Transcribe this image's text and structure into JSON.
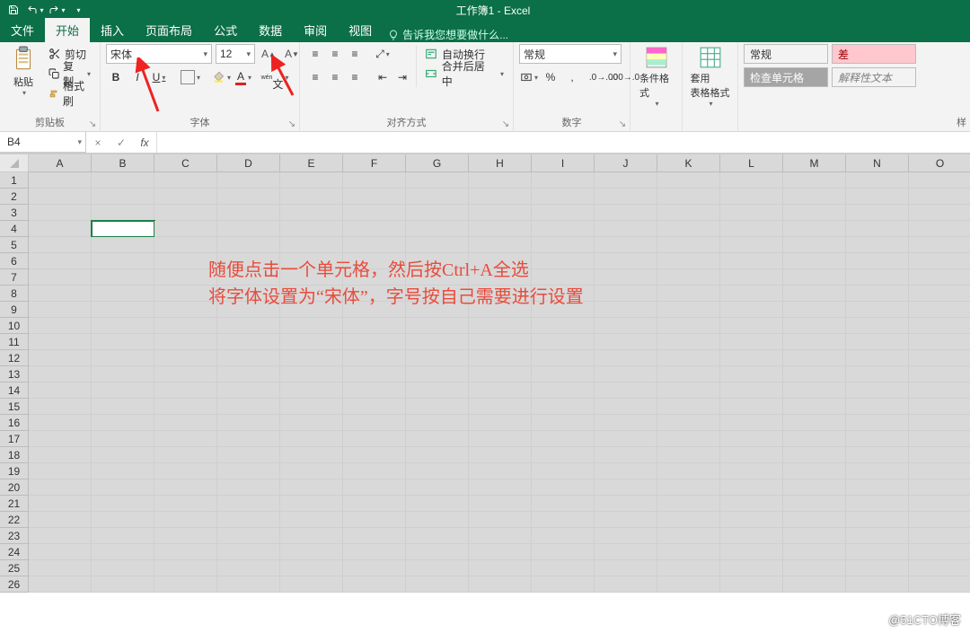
{
  "window": {
    "title": "工作簿1 - Excel"
  },
  "qat": {
    "save": "保存",
    "undo": "撤销",
    "redo": "重做"
  },
  "tabs": {
    "file": "文件",
    "home": "开始",
    "insert": "插入",
    "layout": "页面布局",
    "formulas": "公式",
    "data": "数据",
    "review": "审阅",
    "view": "视图",
    "tellme": "告诉我您想要做什么..."
  },
  "ribbon": {
    "clipboard": {
      "paste": "粘贴",
      "cut": "剪切",
      "copy": "复制",
      "painter": "格式刷",
      "label": "剪贴板"
    },
    "font": {
      "name": "宋体",
      "size": "12",
      "bold": "B",
      "italic": "I",
      "underline": "U",
      "label": "字体"
    },
    "align": {
      "wrap": "自动换行",
      "merge": "合并后居中",
      "label": "对齐方式"
    },
    "number": {
      "format": "常规",
      "percent": "%",
      "label": "数字"
    },
    "cond": {
      "label": "条件格式"
    },
    "tablefmt": {
      "label": "套用\n表格格式"
    },
    "styles": {
      "normal": "常规",
      "bad": "差",
      "check": "检查单元格",
      "explain": "解释性文本",
      "label": "样"
    }
  },
  "namebox": {
    "ref": "B4"
  },
  "fx": {
    "times": "×",
    "check": "✓",
    "fx": "fx"
  },
  "grid": {
    "cols": [
      "A",
      "B",
      "C",
      "D",
      "E",
      "F",
      "G",
      "H",
      "I",
      "J",
      "K",
      "L",
      "M",
      "N",
      "O"
    ],
    "rows": 26,
    "activeRow": 4,
    "activeCol": 1
  },
  "annotations": {
    "line1": "随便点击一个单元格，然后按Ctrl+A全选",
    "line2": "将字体设置为“宋体”，字号按自己需要进行设置"
  },
  "watermark": "@51CTO博客"
}
